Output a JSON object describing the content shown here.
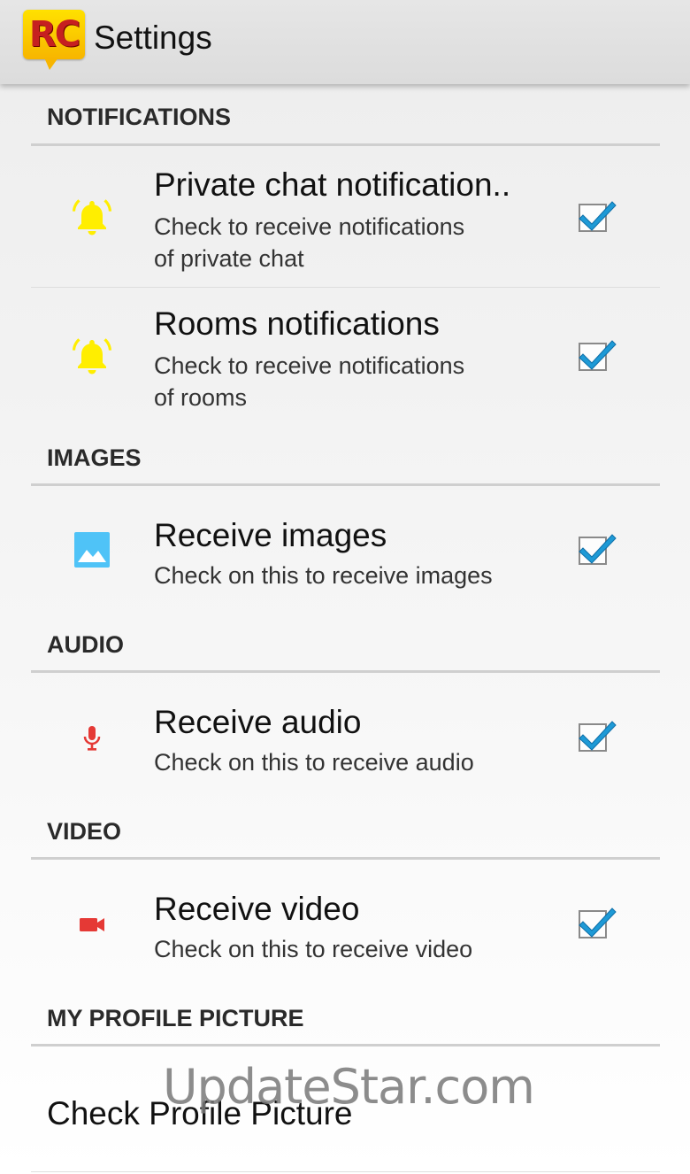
{
  "appbar": {
    "logo_text": "RC",
    "title": "Settings"
  },
  "sections": {
    "notifications": {
      "header": "NOTIFICATIONS"
    },
    "images": {
      "header": "IMAGES"
    },
    "audio": {
      "header": "AUDIO"
    },
    "video": {
      "header": "VIDEO"
    },
    "profile": {
      "header": "MY PROFILE PICTURE"
    }
  },
  "prefs": {
    "private_chat": {
      "icon": "bell-icon",
      "icon_color": "#ffee00",
      "title": "Private chat notification..",
      "summary_line1": "Check to receive notifications",
      "summary_line2": "of private chat",
      "checked": true
    },
    "rooms": {
      "icon": "bell-icon",
      "icon_color": "#ffee00",
      "title": "Rooms notifications",
      "summary_line1": "Check to receive notifications",
      "summary_line2": "of rooms",
      "checked": true
    },
    "images": {
      "icon": "image-icon",
      "icon_color": "#4fc3f7",
      "title": "Receive images",
      "summary": "Check on this to receive images",
      "checked": true
    },
    "audio": {
      "icon": "microphone-icon",
      "icon_color": "#e53935",
      "title": "Receive audio",
      "summary": "Check on this to receive audio",
      "checked": true
    },
    "video": {
      "icon": "video-camera-icon",
      "icon_color": "#e53935",
      "title": "Receive video",
      "summary": "Check on this to receive video",
      "checked": true
    },
    "profile_picture": {
      "title": "Check Profile Picture"
    }
  },
  "colors": {
    "checkmark": "#1e9ad6",
    "section_rule": "#cfcfcf"
  },
  "watermark": "UpdateStar.com"
}
